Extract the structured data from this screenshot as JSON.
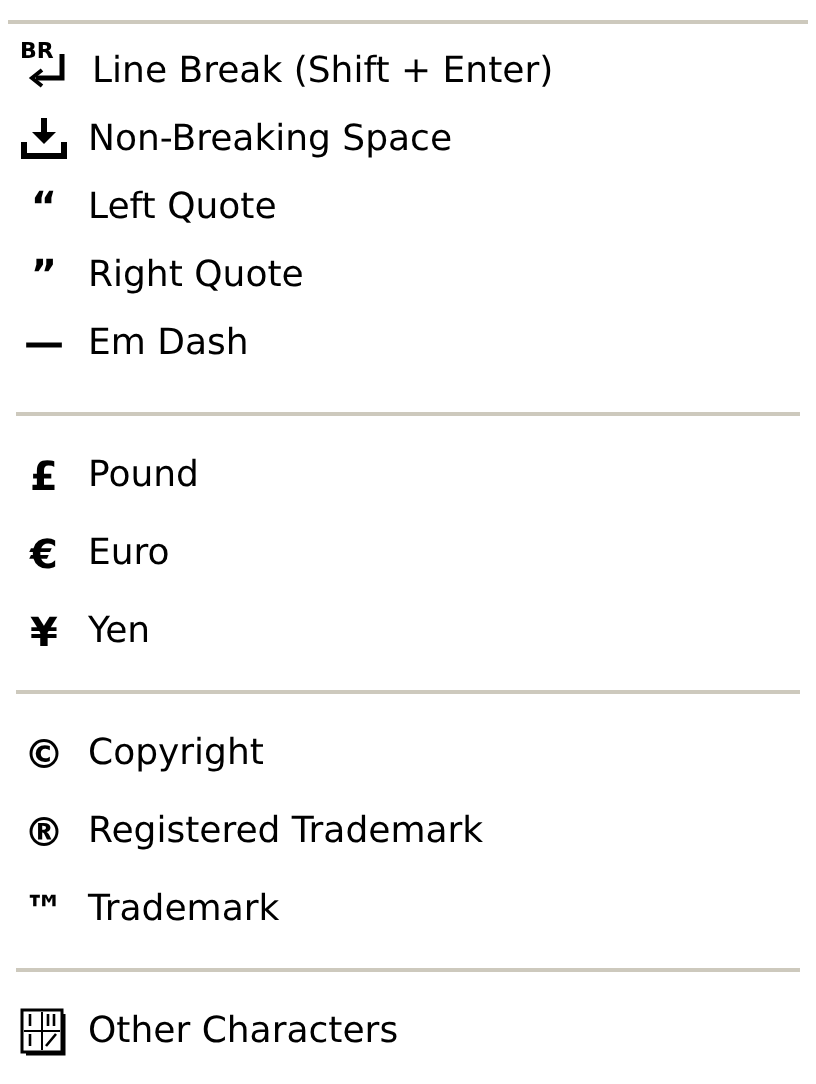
{
  "groups": [
    {
      "items": [
        {
          "kind": "line-break",
          "badge": "BR",
          "label": "Line Break (Shift + Enter)"
        },
        {
          "kind": "nbsp",
          "label": "Non-Breaking Space"
        },
        {
          "kind": "glyph",
          "symbol": "“",
          "label": "Left Quote"
        },
        {
          "kind": "glyph",
          "symbol": "”",
          "label": "Right Quote"
        },
        {
          "kind": "glyph",
          "symbol": "—",
          "label": "Em Dash"
        }
      ]
    },
    {
      "items": [
        {
          "kind": "glyph",
          "symbol": "£",
          "label": "Pound"
        },
        {
          "kind": "glyph",
          "symbol": "€",
          "label": "Euro"
        },
        {
          "kind": "glyph",
          "symbol": "¥",
          "label": "Yen"
        }
      ]
    },
    {
      "items": [
        {
          "kind": "glyph",
          "symbol": "©",
          "label": "Copyright"
        },
        {
          "kind": "glyph",
          "symbol": "®",
          "label": "Registered Trademark"
        },
        {
          "kind": "glyph",
          "symbol": "™",
          "label": "Trademark"
        }
      ]
    },
    {
      "items": [
        {
          "kind": "other",
          "label": "Other Characters"
        }
      ]
    }
  ]
}
